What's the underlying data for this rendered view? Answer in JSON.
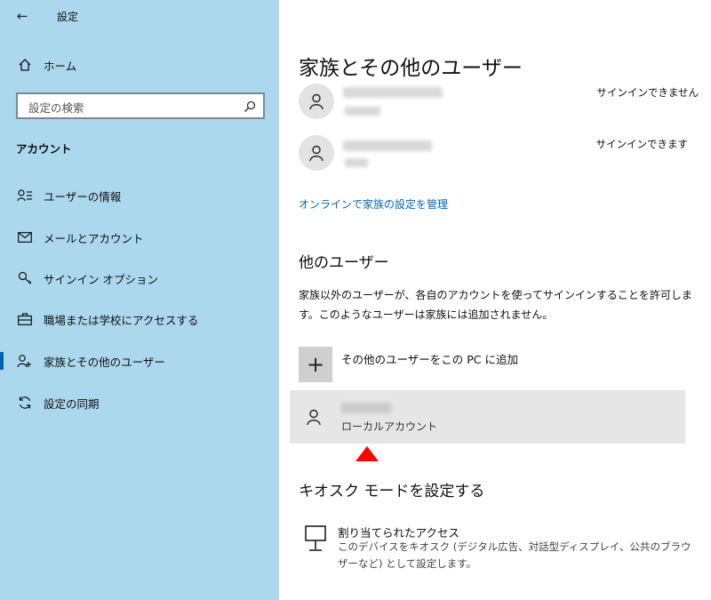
{
  "window": {
    "title": "設定"
  },
  "sidebar": {
    "home_label": "ホーム",
    "search_placeholder": "設定の検索",
    "section_label": "アカウント",
    "items": [
      {
        "label": "ユーザーの情報",
        "icon": "user-info-icon"
      },
      {
        "label": "メールとアカウント",
        "icon": "mail-icon"
      },
      {
        "label": "サインイン オプション",
        "icon": "key-icon"
      },
      {
        "label": "職場または学校にアクセスする",
        "icon": "briefcase-icon"
      },
      {
        "label": "家族とその他のユーザー",
        "icon": "family-icon",
        "active": true
      },
      {
        "label": "設定の同期",
        "icon": "sync-icon"
      }
    ]
  },
  "main": {
    "title": "家族とその他のユーザー",
    "family": [
      {
        "status": "サインインできません"
      },
      {
        "status": "サインインできます"
      }
    ],
    "manage_link": "オンラインで家族の設定を管理",
    "other_users": {
      "heading": "他のユーザー",
      "description": "家族以外のユーザーが、各自のアカウントを使ってサインインすることを許可します。このようなユーザーは家族には追加されません。",
      "add_label": "その他のユーザーをこの PC に追加",
      "local_account_label": "ローカルアカウント"
    },
    "kiosk": {
      "heading": "キオスク モードを設定する",
      "item_title": "割り当てられたアクセス",
      "item_desc": "このデバイスをキオスク (デジタル広告、対話型ディスプレイ、公共のブラウザーなど) として設定します。"
    }
  },
  "colors": {
    "sidebar_bg": "#abd8ec",
    "accent": "#0063b1",
    "link": "#0067b8",
    "marker": "#ff0000"
  }
}
